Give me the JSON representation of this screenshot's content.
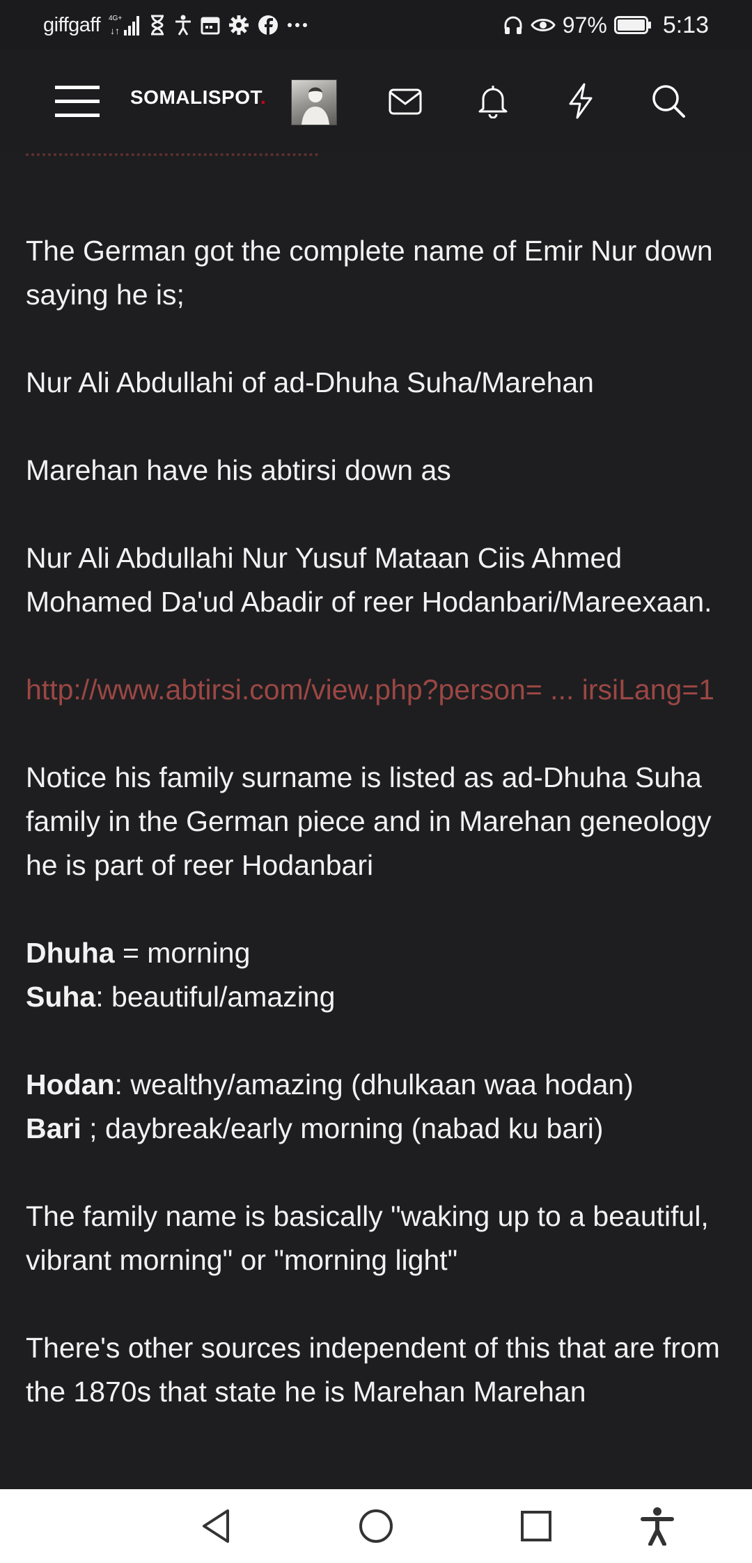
{
  "status_bar": {
    "carrier": "giffgaff",
    "network": "4G+",
    "battery_percent": "97%",
    "time": "5:13",
    "icons": [
      "signal-icon",
      "hourglass-icon",
      "accessibility-icon",
      "calendar-icon",
      "settings-icon",
      "facebook-icon",
      "more-icon",
      "headphones-icon",
      "eye-icon",
      "battery-icon"
    ]
  },
  "navbar": {
    "brand": "SOMALISPOT",
    "brand_dot": ".",
    "icons": [
      "menu-icon",
      "avatar",
      "mail-icon",
      "bell-icon",
      "lightning-icon",
      "search-icon"
    ]
  },
  "post": {
    "p1": "The German got the complete name of Emir Nur down saying he is;",
    "p2": "Nur Ali Abdullahi of ad-Dhuha Suha/Marehan",
    "p3": "Marehan have his abtirsi down as",
    "p4": "Nur Ali Abdullahi Nur Yusuf Mataan Ciis Ahmed Mohamed Da'ud Abadir of reer Hodanbari/Mareexaan.",
    "link": "http://www.abtirsi.com/view.php?person= ... irsiLang=1",
    "p5": "Notice his family surname is listed as ad-Dhuha Suha family in the German piece and in Marehan geneology he is part of reer Hodanbari",
    "defs1": [
      {
        "term": "Dhuha",
        "rest": " = morning"
      },
      {
        "term": "Suha",
        "rest": ": beautiful/amazing"
      }
    ],
    "defs2": [
      {
        "term": "Hodan",
        "rest": ": wealthy/amazing (dhulkaan waa hodan)"
      },
      {
        "term": "Bari",
        "rest": " ; daybreak/early morning (nabad ku bari)"
      }
    ],
    "p6": "The family name is basically \"waking up to a beautiful, vibrant morning\" or \"morning light\"",
    "p7": "There's other sources independent of this that are from the 1870s that state he is Marehan Marehan"
  },
  "system_nav": {
    "buttons": [
      "back-icon",
      "home-icon",
      "recents-icon",
      "accessibility-icon"
    ]
  }
}
